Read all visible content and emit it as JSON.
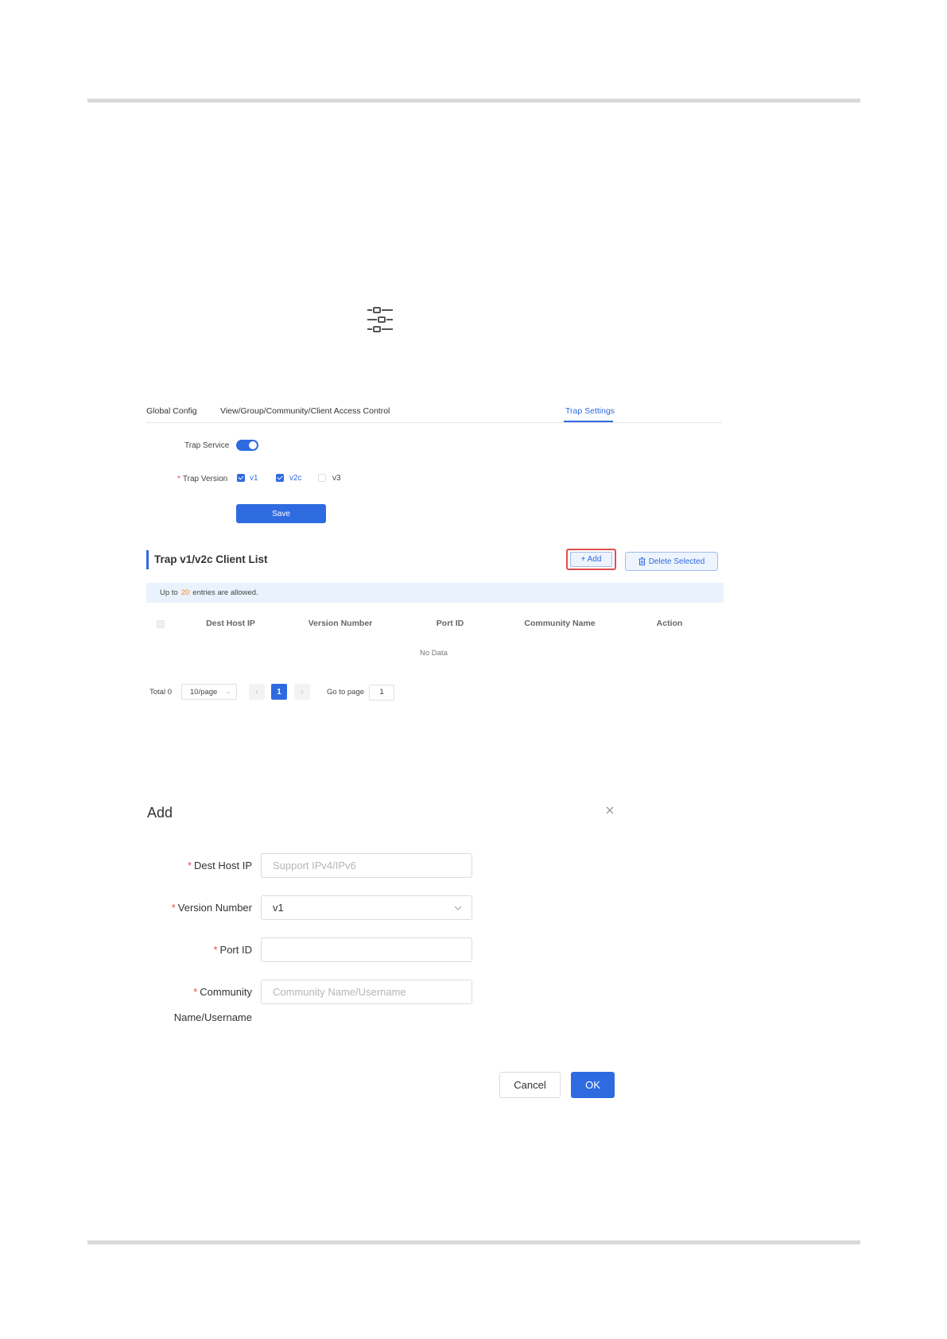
{
  "tabs": [
    {
      "label": "Global Config",
      "active": false
    },
    {
      "label": "View/Group/Community/Client Access Control",
      "active": false
    },
    {
      "label": "Trap Settings",
      "active": true
    }
  ],
  "trap_form": {
    "service_label": "Trap Service",
    "service_on": true,
    "version_label": "Trap Version",
    "required_mark": "*",
    "versions": [
      {
        "label": "v1",
        "checked": true
      },
      {
        "label": "v2c",
        "checked": true
      },
      {
        "label": "v3",
        "checked": false
      }
    ],
    "save_label": "Save"
  },
  "client_list": {
    "title": "Trap v1/v2c Client List",
    "add_label": "+ Add",
    "delete_label": "Delete Selected",
    "info_prefix": "Up to",
    "info_count": "20",
    "info_suffix": "entries are allowed.",
    "columns": [
      "Dest Host IP",
      "Version Number",
      "Port ID",
      "Community Name",
      "Action"
    ],
    "empty_text": "No Data"
  },
  "pagination": {
    "total_label": "Total 0",
    "page_size": "10/page",
    "current_page": "1",
    "goto_label": "Go to page",
    "goto_value": "1"
  },
  "dialog": {
    "title": "Add",
    "required_mark": "*",
    "fields": {
      "dest_host_ip": {
        "label": "Dest Host IP",
        "placeholder": "Support IPv4/IPv6"
      },
      "version_number": {
        "label": "Version Number",
        "value": "v1"
      },
      "port_id": {
        "label": "Port ID",
        "value": ""
      },
      "community": {
        "label_line1": "Community",
        "label_line2": "Name/Username",
        "placeholder": "Community Name/Username"
      }
    },
    "cancel_label": "Cancel",
    "ok_label": "OK"
  },
  "colors": {
    "accent": "#2f6be0",
    "required": "#e34d4d",
    "highlight": "#e34d4d",
    "info_bg": "#eaf3fd",
    "info_number": "#f08a24"
  }
}
